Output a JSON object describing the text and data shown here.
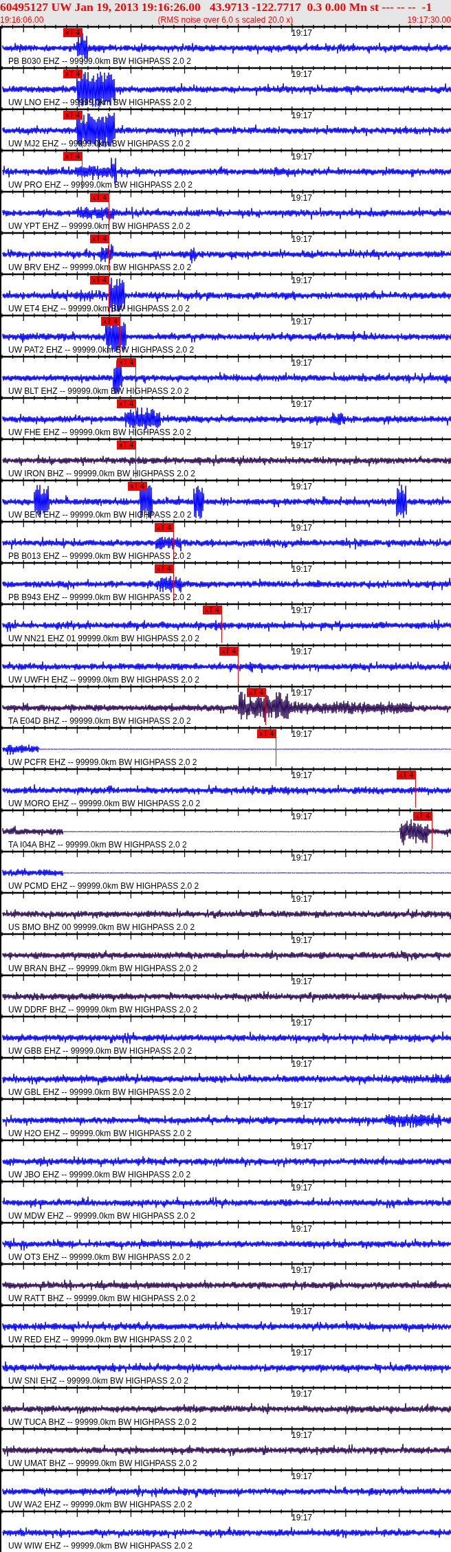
{
  "header": {
    "title": "60495127 UW Jan 19, 2013 19:16:26.00   43.9713 -122.7717  0.3 0.00 Mn st --- -- --  -1",
    "start_time": "19:16:06.00",
    "note": "(RMS noise over 6.0 s scaled 20.0 x)",
    "end_time": "19:17:30.00"
  },
  "traces": [
    {
      "label": "PB B030 EHZ -- 99999.0km BW HIGHPASS 2.0 2",
      "time_label": "19:17",
      "color": "#0000ff",
      "pick": "xT 4"
    },
    {
      "label": "UW LNO EHZ -- 99999.0km BW HIGHPASS 2.0 2",
      "time_label": "19:17",
      "color": "#0000ff",
      "pick": "xT 4"
    },
    {
      "label": "UW MJ2 EHZ -- 99999.0km BW HIGHPASS 2.0 2",
      "time_label": "19:17",
      "color": "#0000ff",
      "pick": "xT 4"
    },
    {
      "label": "UW PRO EHZ -- 99999.0km BW HIGHPASS 2.0 2",
      "time_label": "19:17",
      "color": "#0000ff",
      "pick": "xT 4"
    },
    {
      "label": "UW YPT EHZ -- 99999.0km BW HIGHPASS 2.0 2",
      "time_label": "19:17",
      "color": "#0000ff",
      "pick": "xT 4"
    },
    {
      "label": "UW BRV EHZ -- 99999.0km BW HIGHPASS 2.0 2",
      "time_label": "19:17",
      "color": "#0000ff",
      "pick": "xT 4"
    },
    {
      "label": "UW ET4 EHZ -- 99999.0km BW HIGHPASS 2.0 2",
      "time_label": "19:17",
      "color": "#0000ff",
      "pick": "xT 4"
    },
    {
      "label": "UW PAT2 EHZ -- 99999.0km BW HIGHPASS 2.0 2",
      "time_label": "19:17",
      "color": "#0000ff",
      "pick": "xT 4"
    },
    {
      "label": "UW BLT EHZ -- 99999.0km BW HIGHPASS 2.0 2",
      "time_label": "19:17",
      "color": "#0000ff",
      "pick": "xT 4"
    },
    {
      "label": "UW FHE EHZ -- 99999.0km BW HIGHPASS 2.0 2",
      "time_label": "19:17",
      "color": "#0000ff",
      "pick": "xT 4"
    },
    {
      "label": "UW IRON BHZ -- 99999.0km BW HIGHPASS 2.0 2",
      "time_label": "19:17",
      "color": "#2a0a55",
      "pick": "xT 4"
    },
    {
      "label": "UW BEN EHZ -- 99999.0km BW HIGHPASS 2.0 2",
      "time_label": "19:17",
      "color": "#0000ff",
      "pick": "xT 4"
    },
    {
      "label": "PB B013 EHZ -- 99999.0km BW HIGHPASS 2.0 2",
      "time_label": "19:17",
      "color": "#0000ff",
      "pick": "xT 4"
    },
    {
      "label": "PB B943 EHZ -- 99999.0km BW HIGHPASS 2.0 2",
      "time_label": "19:17",
      "color": "#0000ff",
      "pick": "xT 4"
    },
    {
      "label": "UW NN21 EHZ 01 99999.0km BW HIGHPASS 2.0 2",
      "time_label": "19:17",
      "color": "#0000ff",
      "pick": "xT 4"
    },
    {
      "label": "UW UWFH EHZ -- 99999.0km BW HIGHPASS 2.0 2",
      "time_label": "19:17",
      "color": "#0000ff",
      "pick": "xT 4"
    },
    {
      "label": "TA E04D BHZ -- 99999.0km BW HIGHPASS 2.0 2",
      "time_label": "19:17",
      "color": "#2a0a55",
      "pick": "xT 4"
    },
    {
      "label": "UW PCFR EHZ -- 99999.0km BW HIGHPASS 2.0 2",
      "time_label": "19:17",
      "color": "#0000ff",
      "pick": "xT 4"
    },
    {
      "label": "UW MORO EHZ -- 99999.0km BW HIGHPASS 2.0 2",
      "time_label": "19:17",
      "color": "#0000ff",
      "pick": "xT 4"
    },
    {
      "label": "TA I04A BHZ -- 99999.0km BW HIGHPASS 2.0 2",
      "time_label": "19:17",
      "color": "#2a0a55",
      "pick": "xT 4"
    },
    {
      "label": "UW PCMD EHZ -- 99999.0km BW HIGHPASS 2.0 2",
      "time_label": "19:17",
      "color": "#0000ff"
    },
    {
      "label": "US BMO BHZ 00 99999.0km BW HIGHPASS 2.0 2",
      "time_label": "19:17",
      "color": "#2a0a55"
    },
    {
      "label": "UW BRAN BHZ -- 99999.0km BW HIGHPASS 2.0 2",
      "time_label": "19:17",
      "color": "#2a0a55"
    },
    {
      "label": "UW DDRF BHZ -- 99999.0km BW HIGHPASS 2.0 2",
      "time_label": "19:17",
      "color": "#2a0a55"
    },
    {
      "label": "UW GBB EHZ -- 99999.0km BW HIGHPASS 2.0 2",
      "time_label": "19:17",
      "color": "#0000ff"
    },
    {
      "label": "UW GBL EHZ -- 99999.0km BW HIGHPASS 2.0 2",
      "time_label": "19:17",
      "color": "#0000ff"
    },
    {
      "label": "UW H2O EHZ -- 99999.0km BW HIGHPASS 2.0 2",
      "time_label": "19:17",
      "color": "#0000ff"
    },
    {
      "label": "UW JBO EHZ -- 99999.0km BW HIGHPASS 2.0 2",
      "time_label": "19:17",
      "color": "#0000ff"
    },
    {
      "label": "UW MDW EHZ -- 99999.0km BW HIGHPASS 2.0 2",
      "time_label": "19:17",
      "color": "#0000ff"
    },
    {
      "label": "UW OT3 EHZ -- 99999.0km BW HIGHPASS 2.0 2",
      "time_label": "19:17",
      "color": "#0000ff"
    },
    {
      "label": "UW RATT BHZ -- 99999.0km BW HIGHPASS 2.0 2",
      "time_label": "19:17",
      "color": "#2a0a55"
    },
    {
      "label": "UW RED EHZ -- 99999.0km BW HIGHPASS 2.0 2",
      "time_label": "19:17",
      "color": "#0000ff"
    },
    {
      "label": "UW SNI EHZ -- 99999.0km BW HIGHPASS 2.0 2",
      "time_label": "19:17",
      "color": "#0000ff"
    },
    {
      "label": "UW TUCA BHZ -- 99999.0km BW HIGHPASS 2.0 2",
      "time_label": "19:17",
      "color": "#2a0a55"
    },
    {
      "label": "UW UMAT BHZ -- 99999.0km BW HIGHPASS 2.0 2",
      "time_label": "19:17",
      "color": "#2a0a55"
    },
    {
      "label": "UW WA2 EHZ -- 99999.0km BW HIGHPASS 2.0 2",
      "time_label": "19:17",
      "color": "#0000ff"
    },
    {
      "label": "UW WIW EHZ -- 99999.0km BW HIGHPASS 2.0 2",
      "time_label": "19:17",
      "color": "#0000ff"
    }
  ]
}
